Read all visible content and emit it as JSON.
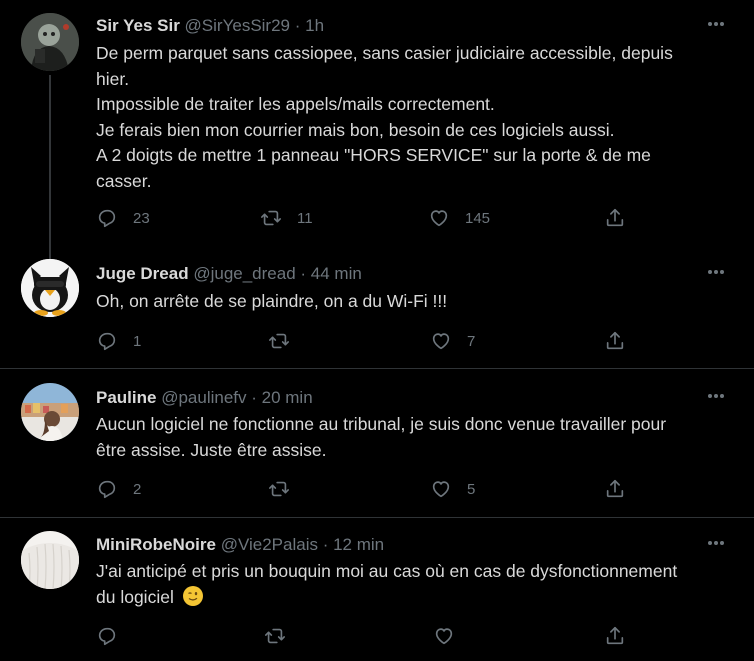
{
  "tweets": [
    {
      "name": "Sir Yes Sir",
      "handle": "@SirYesSir29",
      "time": "· 1h",
      "lines": [
        "De perm parquet sans cassiopee, sans casier judiciaire accessible, depuis",
        "hier.",
        "Impossible de traiter les appels/mails correctement.",
        "Je ferais bien mon courrier mais bon, besoin de ces logiciels aussi.",
        "A 2 doigts de mettre 1 panneau \"HORS SERVICE\" sur la porte & de me",
        "casser."
      ],
      "replies": "23",
      "retweets": "11",
      "likes": "145"
    },
    {
      "name": "Juge Dread",
      "handle": "@juge_dread",
      "time": "· 44 min",
      "lines": [
        "Oh, on arrête de se plaindre, on a du Wi-Fi !!!"
      ],
      "replies": "1",
      "retweets": "",
      "likes": "7"
    },
    {
      "name": "Pauline",
      "handle": "@paulinefv",
      "time": "· 20 min",
      "lines": [
        "Aucun logiciel ne fonctionne au tribunal, je suis donc venue travailler pour",
        "être assise. Juste être assise."
      ],
      "replies": "2",
      "retweets": "",
      "likes": "5"
    },
    {
      "name": "MiniRobeNoire",
      "handle": "@Vie2Palais",
      "time": "· 12 min",
      "lines": [
        "J'ai anticipé et pris un bouquin moi au cas où en cas de dysfonctionnement",
        "du logiciel"
      ],
      "replies": "",
      "retweets": "",
      "likes": ""
    }
  ],
  "icons": {
    "reply": "reply-icon",
    "retweet": "retweet-icon",
    "like": "heart-icon",
    "share": "share-icon",
    "more": "more-icon",
    "emoji": "winking-face-emoji"
  },
  "colors": {
    "background": "#000000",
    "text": "#d9d9d9",
    "muted": "#6e767d",
    "divider": "#2f3336",
    "thread_line": "#333639"
  }
}
